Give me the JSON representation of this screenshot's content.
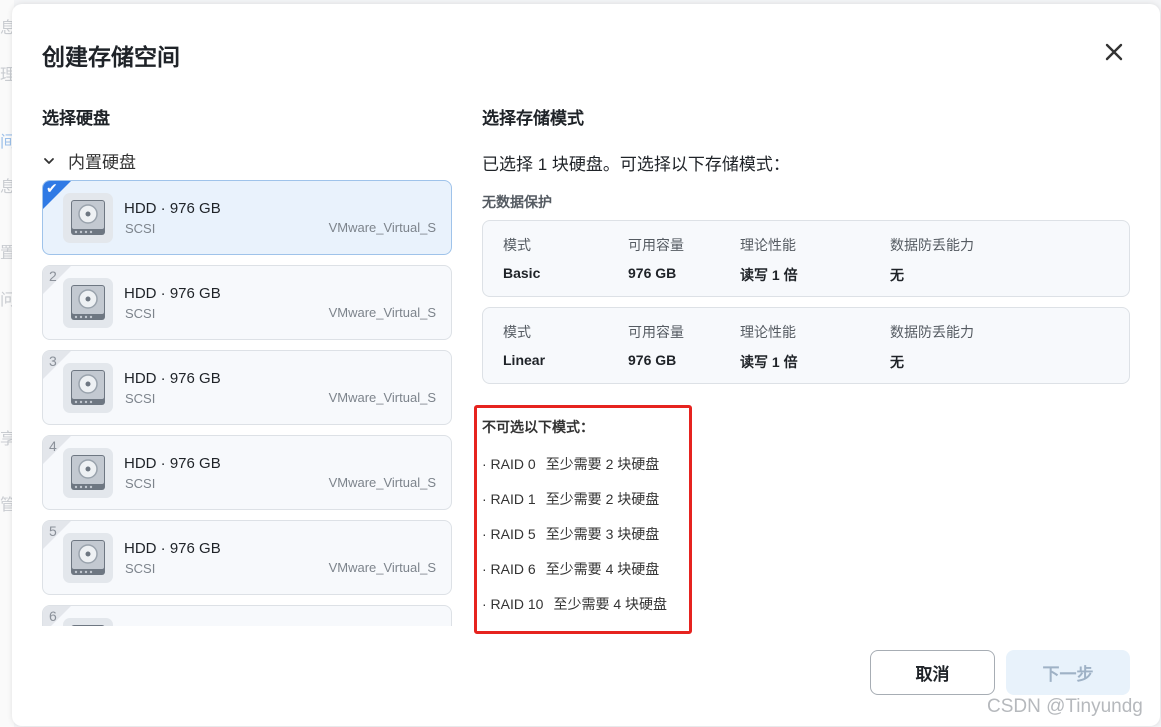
{
  "background": {
    "fragments": [
      "息",
      "理",
      "间",
      "息",
      "置",
      "问",
      "享",
      "管"
    ]
  },
  "dialog": {
    "title": "创建存储空间"
  },
  "left": {
    "section_title": "选择硬盘",
    "group_label": "内置硬盘",
    "disks": [
      {
        "index": "1",
        "selected": true,
        "name": "HDD · 976 GB",
        "interface": "SCSI",
        "model": "VMware_Virtual_S"
      },
      {
        "index": "2",
        "selected": false,
        "name": "HDD · 976 GB",
        "interface": "SCSI",
        "model": "VMware_Virtual_S"
      },
      {
        "index": "3",
        "selected": false,
        "name": "HDD · 976 GB",
        "interface": "SCSI",
        "model": "VMware_Virtual_S"
      },
      {
        "index": "4",
        "selected": false,
        "name": "HDD · 976 GB",
        "interface": "SCSI",
        "model": "VMware_Virtual_S"
      },
      {
        "index": "5",
        "selected": false,
        "name": "HDD · 976 GB",
        "interface": "SCSI",
        "model": "VMware_Virtual_S"
      },
      {
        "index": "6",
        "selected": false,
        "name": "",
        "interface": "",
        "model": ""
      }
    ]
  },
  "right": {
    "section_title": "选择存储模式",
    "selection_info": "已选择 1 块硬盘。可选择以下存储模式：",
    "no_protection_label": "无数据保护",
    "modes": [
      {
        "col_mode": "模式",
        "col_capacity": "可用容量",
        "col_perf": "理论性能",
        "col_protect": "数据防丢能力",
        "mode": "Basic",
        "capacity": "976 GB",
        "perf": "读写 1 倍",
        "protect": "无"
      },
      {
        "col_mode": "模式",
        "col_capacity": "可用容量",
        "col_perf": "理论性能",
        "col_protect": "数据防丢能力",
        "mode": "Linear",
        "capacity": "976 GB",
        "perf": "读写 1 倍",
        "protect": "无"
      }
    ],
    "unavailable_title": "不可选以下模式：",
    "unavailable": [
      {
        "mode": "· RAID 0",
        "need": "至少需要 2 块硬盘"
      },
      {
        "mode": "· RAID 1",
        "need": "至少需要 2 块硬盘"
      },
      {
        "mode": "· RAID 5",
        "need": "至少需要 3 块硬盘"
      },
      {
        "mode": "· RAID 6",
        "need": "至少需要 4 块硬盘"
      },
      {
        "mode": "· RAID 10",
        "need": "至少需要 4 块硬盘"
      }
    ]
  },
  "footer": {
    "cancel_label": "取消",
    "next_label": "下一步",
    "next_enabled": false
  },
  "watermark": "CSDN @Tinyundg",
  "colors": {
    "accent": "#2f7ae5",
    "highlight_border": "#e6231f",
    "selected_bg": "#e9f2fc",
    "disabled_button_bg": "#e8f2fb"
  }
}
